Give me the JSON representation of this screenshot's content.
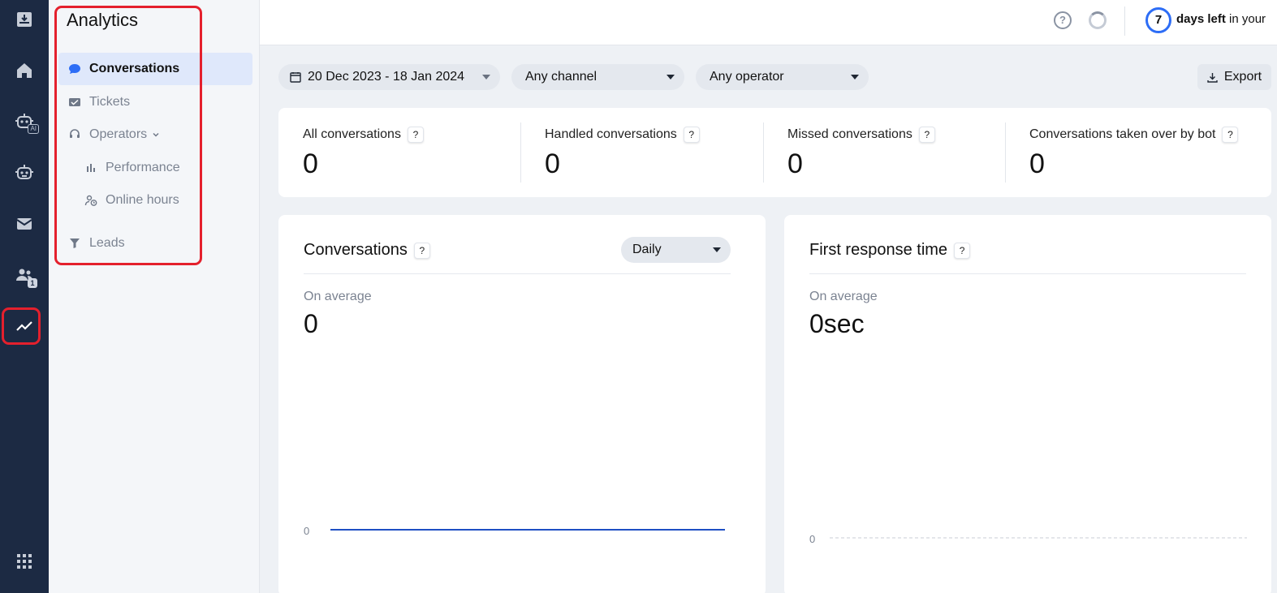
{
  "rail": {
    "items": [
      {
        "name": "inbox-download-icon"
      },
      {
        "name": "home-icon"
      },
      {
        "name": "ai-bot-icon",
        "badge": "AI"
      },
      {
        "name": "bot-icon"
      },
      {
        "name": "mail-icon"
      },
      {
        "name": "contacts-icon",
        "badge": "1"
      },
      {
        "name": "analytics-icon",
        "active": true
      },
      {
        "name": "apps-grid-icon"
      }
    ]
  },
  "subnav": {
    "title": "Analytics",
    "items": [
      {
        "label": "Conversations",
        "icon": "chat-bubble-icon",
        "active": true
      },
      {
        "label": "Tickets",
        "icon": "ticket-icon"
      },
      {
        "label": "Operators",
        "icon": "headset-icon",
        "expandable": true
      },
      {
        "label": "Performance",
        "icon": "bar-chart-icon"
      },
      {
        "label": "Online hours",
        "icon": "user-clock-icon"
      },
      {
        "label": "Leads",
        "icon": "funnel-icon"
      }
    ]
  },
  "header": {
    "days_count": "7",
    "days_left_label": "days left",
    "trial_suffix": "in your"
  },
  "filters": {
    "date_range": "20 Dec 2023 - 18 Jan 2024",
    "channel": "Any channel",
    "operator": "Any operator",
    "export_label": "Export"
  },
  "stats": [
    {
      "label": "All conversations",
      "value": "0"
    },
    {
      "label": "Handled conversations",
      "value": "0"
    },
    {
      "label": "Missed conversations",
      "value": "0"
    },
    {
      "label": "Conversations taken over by bot",
      "value": "0"
    }
  ],
  "help_mark": "?",
  "panels": {
    "conversations": {
      "title": "Conversations",
      "period": "Daily",
      "avg_label": "On average",
      "avg_value": "0",
      "axis_zero": "0"
    },
    "first_response": {
      "title": "First response time",
      "avg_label": "On average",
      "avg_value": "0sec",
      "axis_zero": "0"
    }
  },
  "colors": {
    "accent": "#2d6df6",
    "rail_bg": "#1c2a43",
    "highlight": "#e4202d",
    "line": "#1f4fc4"
  }
}
